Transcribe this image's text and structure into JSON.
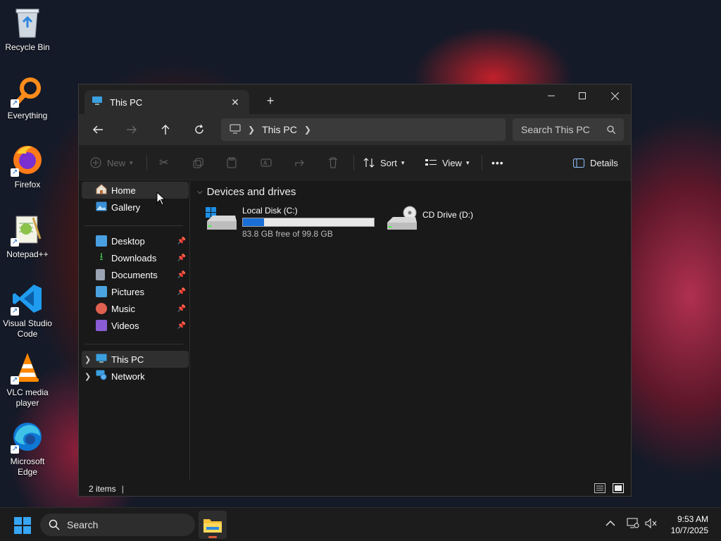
{
  "desktop": {
    "icons": [
      {
        "label": "Recycle Bin",
        "icon": "recycle-bin-icon"
      },
      {
        "label": "Everything",
        "icon": "everything-search-icon"
      },
      {
        "label": "Firefox",
        "icon": "firefox-icon"
      },
      {
        "label": "Notepad++",
        "icon": "notepad-plus-plus-icon"
      },
      {
        "label": "Visual Studio Code",
        "icon": "vscode-icon"
      },
      {
        "label": "VLC media player",
        "icon": "vlc-icon"
      },
      {
        "label": "Microsoft Edge",
        "icon": "edge-icon"
      }
    ]
  },
  "window": {
    "tab_title": "This PC",
    "new_tab": "+",
    "address": {
      "root_icon": "computer-icon",
      "segment": "This PC"
    },
    "search_placeholder": "Search This PC",
    "toolbar": {
      "new_label": "New",
      "sort_label": "Sort",
      "view_label": "View",
      "more_label": "•••",
      "details_label": "Details"
    },
    "sidebar": {
      "quick": [
        {
          "label": "Home",
          "icon": "home-icon",
          "selected": true
        },
        {
          "label": "Gallery",
          "icon": "gallery-icon"
        }
      ],
      "pinned": [
        {
          "label": "Desktop",
          "icon": "desktop-folder-icon",
          "color": "#4a9fe0"
        },
        {
          "label": "Downloads",
          "icon": "download-icon",
          "color": "#3fb950"
        },
        {
          "label": "Documents",
          "icon": "document-icon",
          "color": "#9aa4b2"
        },
        {
          "label": "Pictures",
          "icon": "pictures-icon",
          "color": "#4aa3df"
        },
        {
          "label": "Music",
          "icon": "music-icon",
          "color": "#e06050"
        },
        {
          "label": "Videos",
          "icon": "videos-icon",
          "color": "#8a5cd6"
        }
      ],
      "roots": [
        {
          "label": "This PC",
          "icon": "this-pc-icon",
          "selected": true
        },
        {
          "label": "Network",
          "icon": "network-icon"
        }
      ]
    },
    "content": {
      "group_title": "Devices and drives",
      "drives": [
        {
          "name": "Local Disk (C:)",
          "free_text": "83.8 GB free of 99.8 GB",
          "used_fraction": 0.16
        },
        {
          "name": "CD Drive (D:)"
        }
      ]
    },
    "status": {
      "items": "2 items"
    }
  },
  "taskbar": {
    "search_label": "Search",
    "time": "9:53 AM",
    "date": "10/7/2025"
  }
}
